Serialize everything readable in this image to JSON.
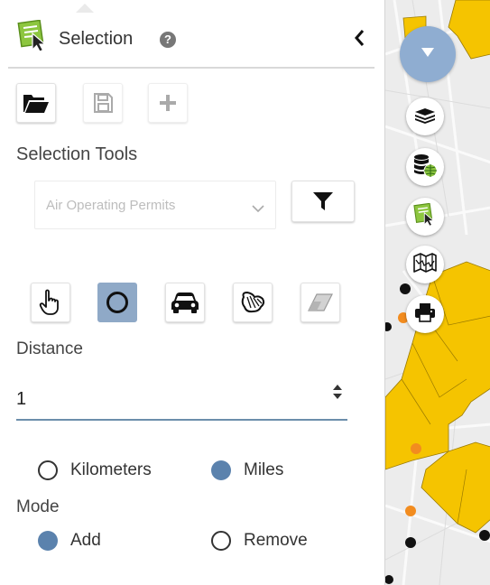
{
  "panel": {
    "title": "Selection",
    "help_glyph": "?",
    "icons": {
      "app": "selection-cursor-icon",
      "help": "question-circle-icon",
      "collapse": "chevron-left-icon"
    }
  },
  "toolbar": {
    "buttons": [
      {
        "name": "open-button",
        "icon": "folder-open-icon",
        "enabled": true
      },
      {
        "name": "save-button",
        "icon": "floppy-disk-icon",
        "enabled": false
      },
      {
        "name": "add-button",
        "icon": "plus-icon",
        "enabled": false
      }
    ]
  },
  "selection_tools": {
    "label": "Selection Tools",
    "layer_select": {
      "value": "Air Operating Permits"
    },
    "filter_icon": "filter-icon",
    "tools": [
      {
        "name": "point",
        "icon": "hand-pointer-icon",
        "active": false
      },
      {
        "name": "circle",
        "icon": "circle-icon",
        "active": true
      },
      {
        "name": "vehicle",
        "icon": "car-icon",
        "active": false
      },
      {
        "name": "freehand",
        "icon": "freehand-polygon-icon",
        "active": false
      },
      {
        "name": "eraser",
        "icon": "eraser-icon",
        "active": false
      }
    ]
  },
  "distance": {
    "label": "Distance",
    "value": "1"
  },
  "units": {
    "options": [
      "Kilometers",
      "Miles"
    ],
    "selected": "Miles"
  },
  "mode": {
    "label": "Mode",
    "options": [
      "Add",
      "Remove"
    ],
    "selected": "Add"
  },
  "map": {
    "buttons": [
      "caret-down-icon",
      "layers-icon",
      "database-globe-icon",
      "selection-cursor-icon",
      "map-icon",
      "printer-icon"
    ],
    "colors": {
      "highlight": "#f5c400",
      "point_orange": "#f28c1f",
      "point_black": "#111111",
      "accent_blue": "#8fadd1"
    }
  },
  "theme": {
    "active_tool": "#8fa9c7",
    "radio_on": "#5b82ad",
    "input_underline": "#6c8eab"
  }
}
